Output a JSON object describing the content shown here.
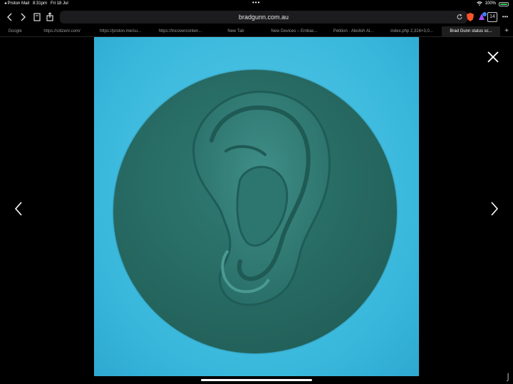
{
  "status_bar": {
    "back_app": "◂ Proton Mail",
    "time": "8:31pm",
    "date": "Fri 18 Jul",
    "dots": "•••",
    "battery": "100%"
  },
  "toolbar": {
    "url": "bradgunn.com.au",
    "tab_count": "14",
    "more": "•••"
  },
  "tabs": [
    {
      "label": "Google"
    },
    {
      "label": "https://citizenr.com/"
    },
    {
      "label": "https://proton.me/su..."
    },
    {
      "label": "https://tncoverconten..."
    },
    {
      "label": "New Tab"
    },
    {
      "label": "New Devices – Embac..."
    },
    {
      "label": "Petition · Abolish Al..."
    },
    {
      "label": "index.php 2,316×3,0..."
    },
    {
      "label": "Brad Gunn status sc..."
    }
  ],
  "colors": {
    "background": "#000000",
    "photo_bg": "#39b8dc",
    "disc": "#25665f"
  }
}
